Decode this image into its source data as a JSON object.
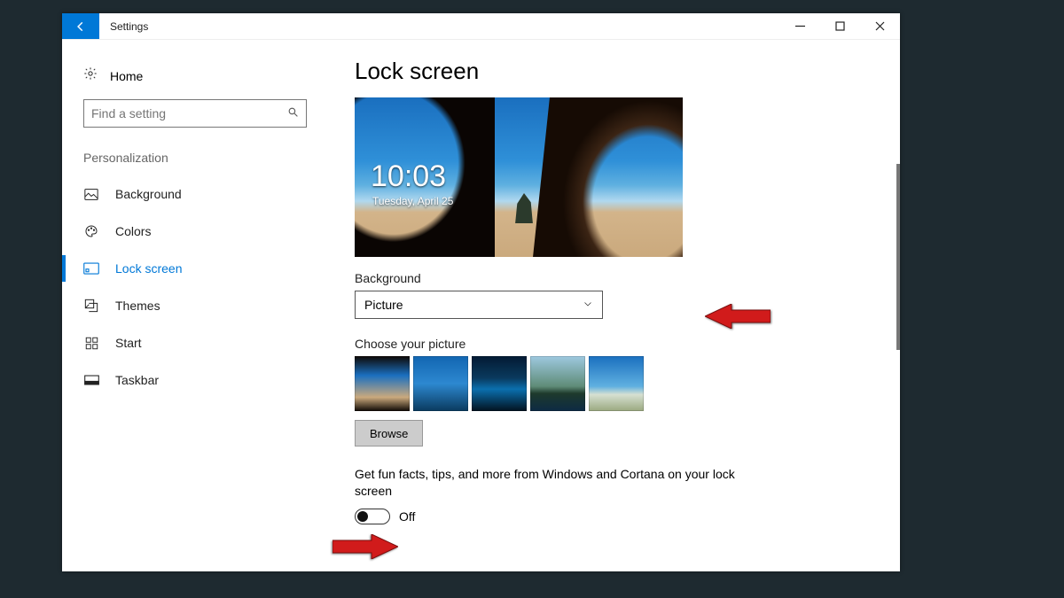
{
  "titlebar": {
    "title": "Settings"
  },
  "sidebar": {
    "home_label": "Home",
    "search_placeholder": "Find a setting",
    "category_label": "Personalization",
    "items": [
      {
        "label": "Background",
        "active": false
      },
      {
        "label": "Colors",
        "active": false
      },
      {
        "label": "Lock screen",
        "active": true
      },
      {
        "label": "Themes",
        "active": false
      },
      {
        "label": "Start",
        "active": false
      },
      {
        "label": "Taskbar",
        "active": false
      }
    ]
  },
  "main": {
    "page_title": "Lock screen",
    "preview": {
      "time": "10:03",
      "date": "Tuesday, April 25"
    },
    "background_label": "Background",
    "background_value": "Picture",
    "choose_picture_label": "Choose your picture",
    "browse_label": "Browse",
    "tips_label": "Get fun facts, tips, and more from Windows and Cortana on your lock screen",
    "tips_toggle_state": "Off"
  },
  "colors": {
    "accent": "#0078d7",
    "arrow": "#d11b1b"
  }
}
